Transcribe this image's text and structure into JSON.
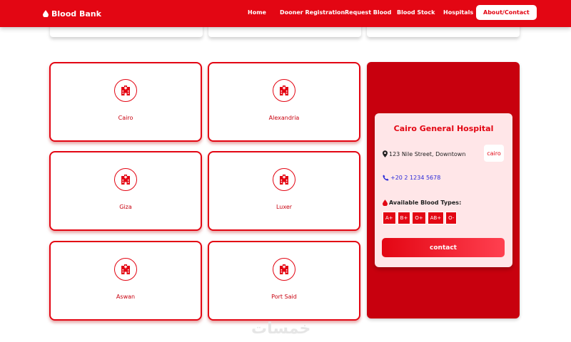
{
  "navbar": {
    "brand": "Blood Bank",
    "links": [
      "Home",
      "Dooner Registration",
      "Request Blood",
      "Blood Stock",
      "Hospitals",
      "About/Contact"
    ],
    "active": "About/Contact"
  },
  "cities": [
    "Cairo",
    "Alexandria",
    "Giza",
    "Luxer",
    "Aswan",
    "Port Said"
  ],
  "hospital": {
    "name": "Cairo General Hospital",
    "address": "123 Nile Street, Downtown",
    "city_tag": "cairo",
    "phone": "+20 2 1234 5678",
    "types_label": "Available Blood Types:",
    "types": [
      "A+",
      "B+",
      "O+",
      "AB+",
      "O-"
    ],
    "contact_label": "contact"
  },
  "watermark": "خمسات",
  "colors": {
    "primary": "#e30613",
    "panel": "#c8000e",
    "card_bg": "#ffe6e8",
    "phone": "#2b2bd9"
  },
  "icons": {
    "brand": "blood-drop-icon",
    "city": "hospital-icon",
    "address": "map-pin-icon",
    "phone": "phone-icon",
    "types": "blood-drop-icon"
  }
}
